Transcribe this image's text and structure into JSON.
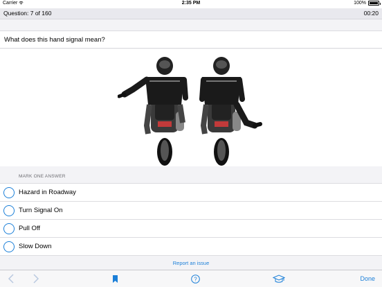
{
  "status_bar": {
    "carrier": "Carrier",
    "time": "2:35 PM",
    "battery": "100%",
    "battery_level": 1.0
  },
  "header": {
    "question_number": "Question: 7 of 160",
    "timer": "00:20"
  },
  "question": {
    "text": "What does this hand signal mean?"
  },
  "answers": {
    "section_label": "MARK ONE ANSWER",
    "options": [
      {
        "label": "Hazard in Roadway",
        "selected": false
      },
      {
        "label": "Turn Signal On",
        "selected": false
      },
      {
        "label": "Pull Off",
        "selected": false
      },
      {
        "label": "Slow Down",
        "selected": false
      }
    ]
  },
  "report_link": "Report an issue",
  "toolbar": {
    "back_icon": "chevron-left-icon",
    "forward_icon": "chevron-right-icon",
    "bookmark_icon": "bookmark-icon",
    "help_icon": "question-circle-icon",
    "study_icon": "graduation-cap-icon",
    "done_label": "Done"
  },
  "colors": {
    "accent": "#1b7fd8",
    "disabled": "#b9c9e0",
    "background": "#f3f3f6"
  }
}
